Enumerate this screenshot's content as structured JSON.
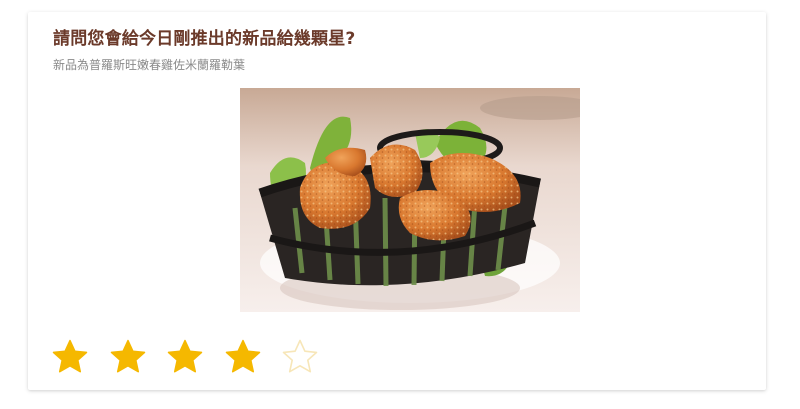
{
  "survey": {
    "question": "請問您會給今日剛推出的新品給幾顆星?",
    "subtitle": "新品為普羅斯旺嫩春雞佐米蘭羅勒葉",
    "image_icon": "fried-chicken-photo"
  },
  "rating": {
    "max": 5,
    "value": 4,
    "filled_color": "#f5b800",
    "empty_color": "#f7e6b8"
  }
}
